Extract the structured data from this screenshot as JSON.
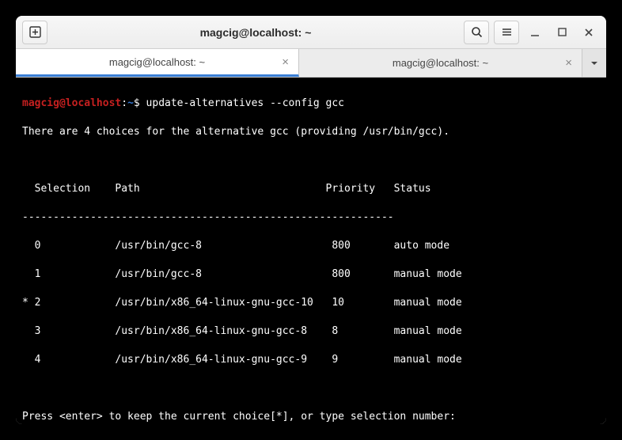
{
  "titlebar": {
    "title": "magcig@localhost: ~"
  },
  "tabs": [
    {
      "label": "magcig@localhost: ~",
      "active": true
    },
    {
      "label": "magcig@localhost: ~",
      "active": false
    }
  ],
  "prompt": {
    "user_host": "magcig@localhost",
    "colon": ":",
    "path": "~",
    "dollar": "$"
  },
  "terminal": {
    "command": "update-alternatives --config gcc",
    "intro": "There are 4 choices for the alternative gcc (providing /usr/bin/gcc).",
    "header": "  Selection    Path                              Priority   Status",
    "separator": "------------------------------------------------------------",
    "rows": [
      "  0            /usr/bin/gcc-8                     800       auto mode",
      "  1            /usr/bin/gcc-8                     800       manual mode",
      "* 2            /usr/bin/x86_64-linux-gnu-gcc-10   10        manual mode",
      "  3            /usr/bin/x86_64-linux-gnu-gcc-8    8         manual mode",
      "  4            /usr/bin/x86_64-linux-gnu-gcc-9    9         manual mode"
    ],
    "footer": "Press <enter> to keep the current choice[*], or type selection number:"
  }
}
